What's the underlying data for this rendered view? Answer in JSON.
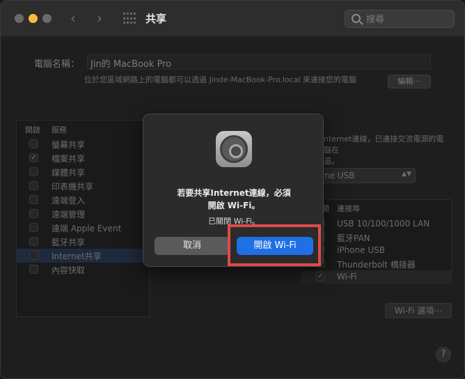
{
  "window": {
    "title": "共享",
    "search_placeholder": "搜尋"
  },
  "background": {
    "computer_name_label": "電腦名稱：",
    "computer_name_value": "Jin的 MacBook Pro",
    "local_description": "位於您區域網路上的電腦都可以透過 Jinde-MacBook-Pro.local 來連接您的電腦",
    "edit_button": "編輯⋯",
    "services_header_on": "開啟",
    "services_header_service": "服務",
    "services": [
      {
        "label": "螢幕共享",
        "checked": false
      },
      {
        "label": "檔案共享",
        "checked": true
      },
      {
        "label": "媒體共享",
        "checked": false
      },
      {
        "label": "印表機共享",
        "checked": false
      },
      {
        "label": "遠端登入",
        "checked": false
      },
      {
        "label": "遠端管理",
        "checked": false
      },
      {
        "label": "遠端 Apple Event",
        "checked": false
      },
      {
        "label": "藍牙共享",
        "checked": false
      },
      {
        "label": "Internet共享",
        "checked": false,
        "selected": true
      },
      {
        "label": "內容快取",
        "checked": false
      }
    ],
    "right_description": "nternet連線，已連接交流電源的電腦在",
    "right_description_2": "還。",
    "share_from_value": "ne USB",
    "ports_header_on": "開",
    "ports_header_to": "連接埠",
    "ports": [
      {
        "label": "USB 10/100/1000 LAN",
        "checked": false
      },
      {
        "label": "藍牙PAN",
        "checked": false
      },
      {
        "label": "iPhone USB",
        "checked": false
      },
      {
        "label": "Thunderbolt 橋接器",
        "checked": false
      },
      {
        "label": "Wi-Fi",
        "checked": true
      }
    ],
    "wifi_options_button": "Wi-Fi 選項⋯",
    "help_button": "?"
  },
  "alert": {
    "title_line1": "若要共享Internet連線，必須",
    "title_line2": "開啟 Wi-Fi。",
    "message": "已關閉 Wi-Fi。",
    "cancel_button": "取消",
    "confirm_button": "開啟 Wi-Fi"
  },
  "colors": {
    "primary_button": "#1f6fe5",
    "highlight_border": "#e04b48",
    "minimize_light": "#f5bd3a"
  }
}
